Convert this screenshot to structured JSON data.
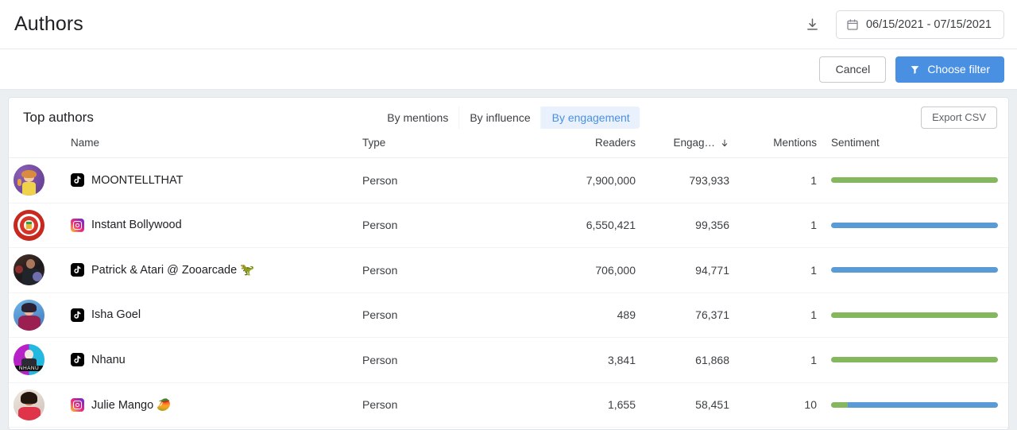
{
  "header": {
    "title": "Authors",
    "download_icon": "download-icon",
    "calendar_icon": "calendar-icon",
    "date_range": "06/15/2021 - 07/15/2021"
  },
  "filter_bar": {
    "cancel_label": "Cancel",
    "choose_filter_label": "Choose filter",
    "filter_icon": "funnel-icon",
    "primary_color": "#4a90e2"
  },
  "card": {
    "title": "Top authors",
    "export_label": "Export CSV",
    "tabs": [
      {
        "label": "By mentions",
        "active": false
      },
      {
        "label": "By influence",
        "active": false
      },
      {
        "label": "By engagement",
        "active": true
      }
    ]
  },
  "table": {
    "columns": [
      "",
      "Name",
      "Type",
      "Readers",
      "Engag…",
      "Mentions",
      "Sentiment"
    ],
    "sort_column": "Engag…",
    "sort_icon": "arrow-down-icon",
    "sentiment_colors": {
      "positive": "#85b75f",
      "neutral": "#5b9bd5",
      "track": "#e8eaed"
    },
    "rows": [
      {
        "avatar": "avatar-moontellthat",
        "platform": "tiktok-icon",
        "name": "MOONTELLTHAT",
        "type": "Person",
        "readers": "7,900,000",
        "engagement": "793,933",
        "mentions": "1",
        "sentiment": [
          {
            "tone": "positive",
            "pct": 100
          }
        ]
      },
      {
        "avatar": "avatar-instant-bollywood",
        "platform": "instagram-icon",
        "name": "Instant Bollywood",
        "type": "Person",
        "readers": "6,550,421",
        "engagement": "99,356",
        "mentions": "1",
        "sentiment": [
          {
            "tone": "neutral",
            "pct": 100
          }
        ]
      },
      {
        "avatar": "avatar-patrick-atari",
        "platform": "tiktok-icon",
        "name": "Patrick & Atari @ Zooarcade 🦖",
        "type": "Person",
        "readers": "706,000",
        "engagement": "94,771",
        "mentions": "1",
        "sentiment": [
          {
            "tone": "neutral",
            "pct": 100
          }
        ]
      },
      {
        "avatar": "avatar-isha-goel",
        "platform": "tiktok-icon",
        "name": "Isha Goel",
        "type": "Person",
        "readers": "489",
        "engagement": "76,371",
        "mentions": "1",
        "sentiment": [
          {
            "tone": "positive",
            "pct": 100
          }
        ]
      },
      {
        "avatar": "avatar-nhanu",
        "platform": "tiktok-icon",
        "name": "Nhanu",
        "type": "Person",
        "readers": "3,841",
        "engagement": "61,868",
        "mentions": "1",
        "sentiment": [
          {
            "tone": "positive",
            "pct": 100
          }
        ]
      },
      {
        "avatar": "avatar-julie-mango",
        "platform": "instagram-icon",
        "name": "Julie Mango 🥭",
        "type": "Person",
        "readers": "1,655",
        "engagement": "58,451",
        "mentions": "10",
        "sentiment": [
          {
            "tone": "positive",
            "pct": 10
          },
          {
            "tone": "neutral",
            "pct": 90
          }
        ]
      }
    ]
  }
}
